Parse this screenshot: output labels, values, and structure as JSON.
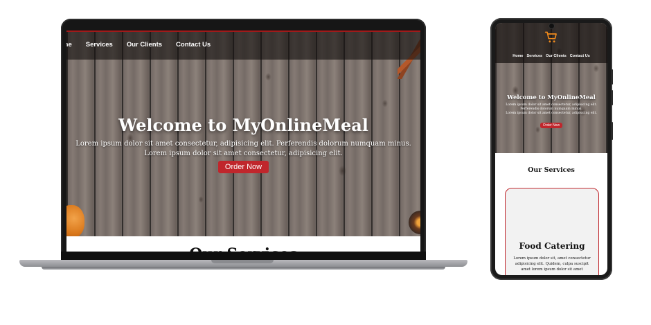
{
  "brand_color": "#c0262c",
  "laptop": {
    "nav": {
      "items": [
        "me",
        "Services",
        "Our Clients",
        "Contact Us"
      ]
    },
    "hero": {
      "heading": "Welcome to MyOnlineMeal",
      "body_line1": "Lorem ipsum dolor sit amet consectetur, adipisicing elit. Perferendis dolorum numquam minus.",
      "body_line2": "Lorem ipsum dolor sit amet consectetur, adipisicing elit.",
      "cta_label": "Order Now"
    },
    "services": {
      "title": "Our Services"
    }
  },
  "phone": {
    "nav": {
      "logo_icon": "shopping-cart-icon",
      "items": [
        "Home",
        "Services",
        "Our Clients",
        "Contact Us"
      ]
    },
    "hero": {
      "heading": "Welcome to MyOnlineMeal",
      "body_line1": "Lorem ipsum dolor sit amet consectetur, adipisicing elit.",
      "body_line2": "Perferendis dolorum numquam minus.",
      "body_line3": "Lorem ipsum dolor sit amet consectetur, adipisicing elit.",
      "cta_label": "Order Now"
    },
    "services": {
      "title": "Our Services",
      "card_title": "Food Catering",
      "card_line1": "Lorem ipsum dolor sit, amet consectetur",
      "card_line2": "adipisicing elit. Quidem, culpa suscipit",
      "card_line3": "amet lorem ipsum dolor sit amet"
    }
  }
}
